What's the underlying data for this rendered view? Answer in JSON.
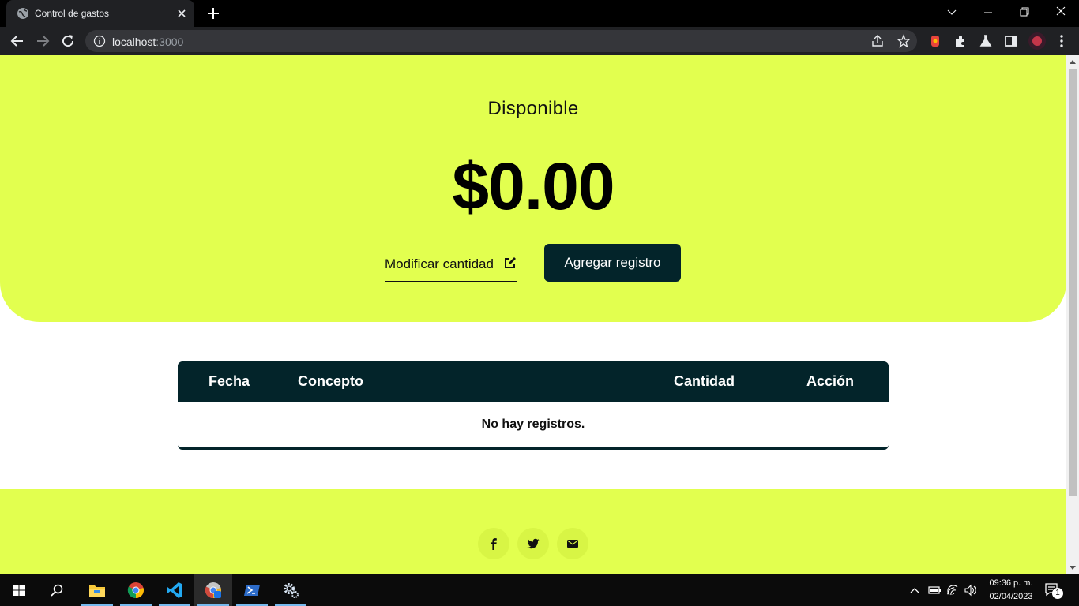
{
  "browser": {
    "tab_title": "Control de gastos",
    "url_host": "localhost",
    "url_port": ":3000"
  },
  "hero": {
    "label": "Disponible",
    "amount": "$0.00",
    "modify_label": "Modificar cantidad",
    "add_label": "Agregar registro"
  },
  "table": {
    "headers": [
      "Fecha",
      "Concepto",
      "Cantidad",
      "Acción"
    ],
    "empty_message": "No hay registros."
  },
  "footer": {
    "icons": [
      "facebook-icon",
      "twitter-icon",
      "mail-icon"
    ]
  },
  "taskbar": {
    "time": "09:36 p. m.",
    "date": "02/04/2023",
    "notification_count": "1"
  },
  "colors": {
    "accent": "#e2ff4f",
    "dark": "#03242a"
  }
}
